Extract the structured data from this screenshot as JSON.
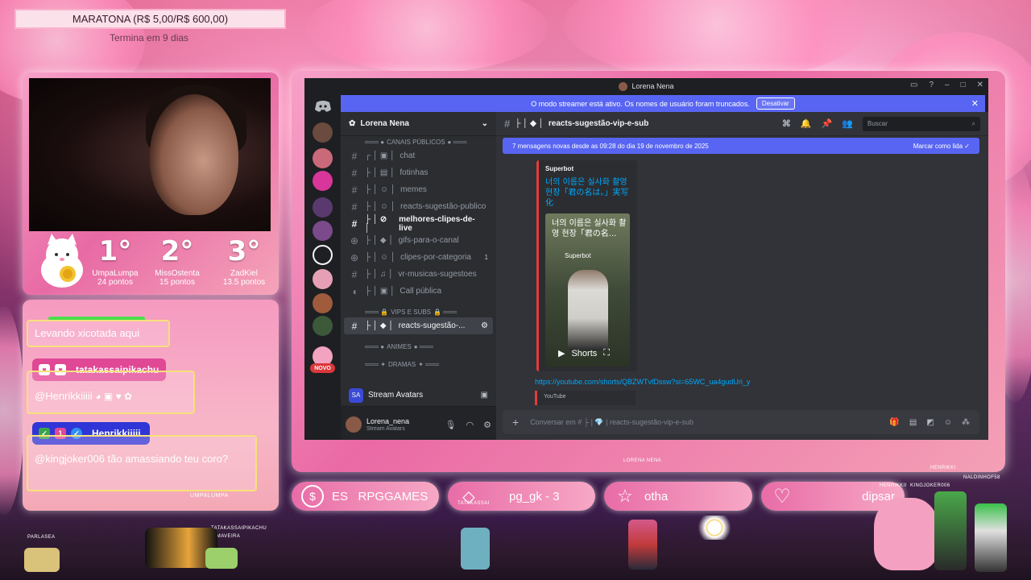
{
  "goal": {
    "title": "MARATONA (R$ 5,00/R$ 600,00)",
    "subtitle": "Termina em 9 dias"
  },
  "leaderboard": [
    {
      "pos": "1°",
      "name": "UmpaLumpa",
      "points": "24 pontos"
    },
    {
      "pos": "2°",
      "name": "MissOstenta",
      "points": "15 pontos"
    },
    {
      "pos": "3°",
      "name": "ZadKiel",
      "points": "13.5 pontos"
    }
  ],
  "chat": {
    "messages": [
      {
        "text": "Levando xicotada aqui"
      },
      {
        "user": "tatakassaipikachu",
        "text": "@Henrikkiiiii"
      },
      {
        "user": "Henrikkiiiii",
        "text": "@kingjoker006 tão amassiando teu coro?"
      }
    ],
    "footer_label": "UMPALUMPA"
  },
  "discord": {
    "window_title": "Lorena Nena",
    "banner_text": "O modo streamer está ativo. Os nomes de usuário foram truncados.",
    "banner_button": "Desativar",
    "server_name": "Lorena Nena",
    "categories": {
      "public": "CANAIS PÚBLICOS",
      "vips": "VIPS E SUBS",
      "animes": "ANIMES",
      "dramas": "DRAMAS"
    },
    "channels": [
      {
        "name": "chat"
      },
      {
        "name": "fotinhas"
      },
      {
        "name": "memes"
      },
      {
        "name": "reacts-sugestão-publico"
      },
      {
        "name": "melhores-clipes-de-live"
      },
      {
        "name": "gifs-para-o-canal"
      },
      {
        "name": "clipes-por-categoria",
        "badge": "1"
      },
      {
        "name": "vr-musicas-sugestoes"
      },
      {
        "name": "Call pública"
      }
    ],
    "active_channel": "reacts-sugestão-...",
    "current_channel": "reacts-sugestão-vip-e-sub",
    "search_placeholder": "Buscar",
    "new_messages": "7 mensagens novas desde as 09:28 do dia 19 de novembro de 2025",
    "mark_read": "Marcar como lida",
    "embed": {
      "author": "Superbot",
      "title": "너의 이름은 실사화 촬영 현장「君の名は。」実写化",
      "thumb_text": "너의 이름은 실사화 촬영 현장「君の名...",
      "thumb_channel": "Superbot",
      "shorts_label": "Shorts"
    },
    "link": "https://youtube.com/shorts/QBZWTvfDssw?si=65WC_ua4gudUri_y",
    "link_provider": "YouTube",
    "stream_avatars": "Stream Avatars",
    "user": {
      "name": "Lorena_nena",
      "status": "Stream Avatars"
    },
    "new_badge": "NOVO",
    "composer_placeholder": "Conversar em # ├ | 💎 | reacts-sugestão-vip-e-sub"
  },
  "stream_label": "LORENA NENA",
  "bottom_pills": [
    {
      "icon": "dollar-icon",
      "text": "ES   RPGGAMES"
    },
    {
      "icon": "diamond-icon",
      "text": "pg_gk - 3"
    },
    {
      "icon": "star-icon",
      "text": "otha"
    },
    {
      "icon": "heart-icon",
      "text": "dipsar"
    }
  ],
  "sprite_labels": [
    "PARLASEA",
    "TATAKASSAIPIKACHU",
    "DIMAVEIRA",
    "TATAKASSAI",
    "HENRIKKI",
    "HENRIKKII",
    "KINGJOKER006",
    "NALDINHOF58"
  ],
  "colors": {
    "accent": "#5865f2",
    "pink": "#e86ca7",
    "discord_bg": "#313338"
  }
}
